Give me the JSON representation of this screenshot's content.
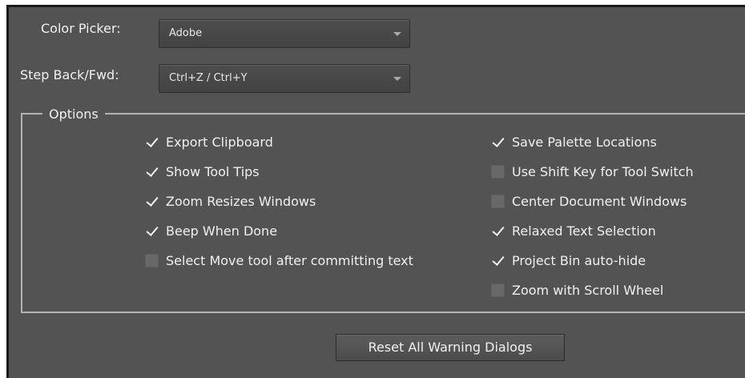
{
  "labels": {
    "color_picker": "Color Picker:",
    "step_back": "Step Back/Fwd:"
  },
  "combos": {
    "color_picker_value": "Adobe",
    "step_back_value": "Ctrl+Z / Ctrl+Y"
  },
  "options_group": {
    "title": "Options",
    "left": [
      {
        "label": "Export Clipboard",
        "checked": true
      },
      {
        "label": "Show Tool Tips",
        "checked": true
      },
      {
        "label": "Zoom Resizes Windows",
        "checked": true
      },
      {
        "label": "Beep When Done",
        "checked": true
      },
      {
        "label": "Select Move tool after committing text",
        "checked": false
      }
    ],
    "right": [
      {
        "label": "Save Palette Locations",
        "checked": true
      },
      {
        "label": "Use Shift Key for Tool Switch",
        "checked": false
      },
      {
        "label": "Center Document Windows",
        "checked": false
      },
      {
        "label": "Relaxed Text Selection",
        "checked": true
      },
      {
        "label": "Project Bin auto-hide",
        "checked": true
      },
      {
        "label": "Zoom with Scroll Wheel",
        "checked": false
      }
    ]
  },
  "reset_button": "Reset All Warning Dialogs",
  "colors": {
    "panel_bg": "#535353",
    "text": "#f0f0f0"
  }
}
